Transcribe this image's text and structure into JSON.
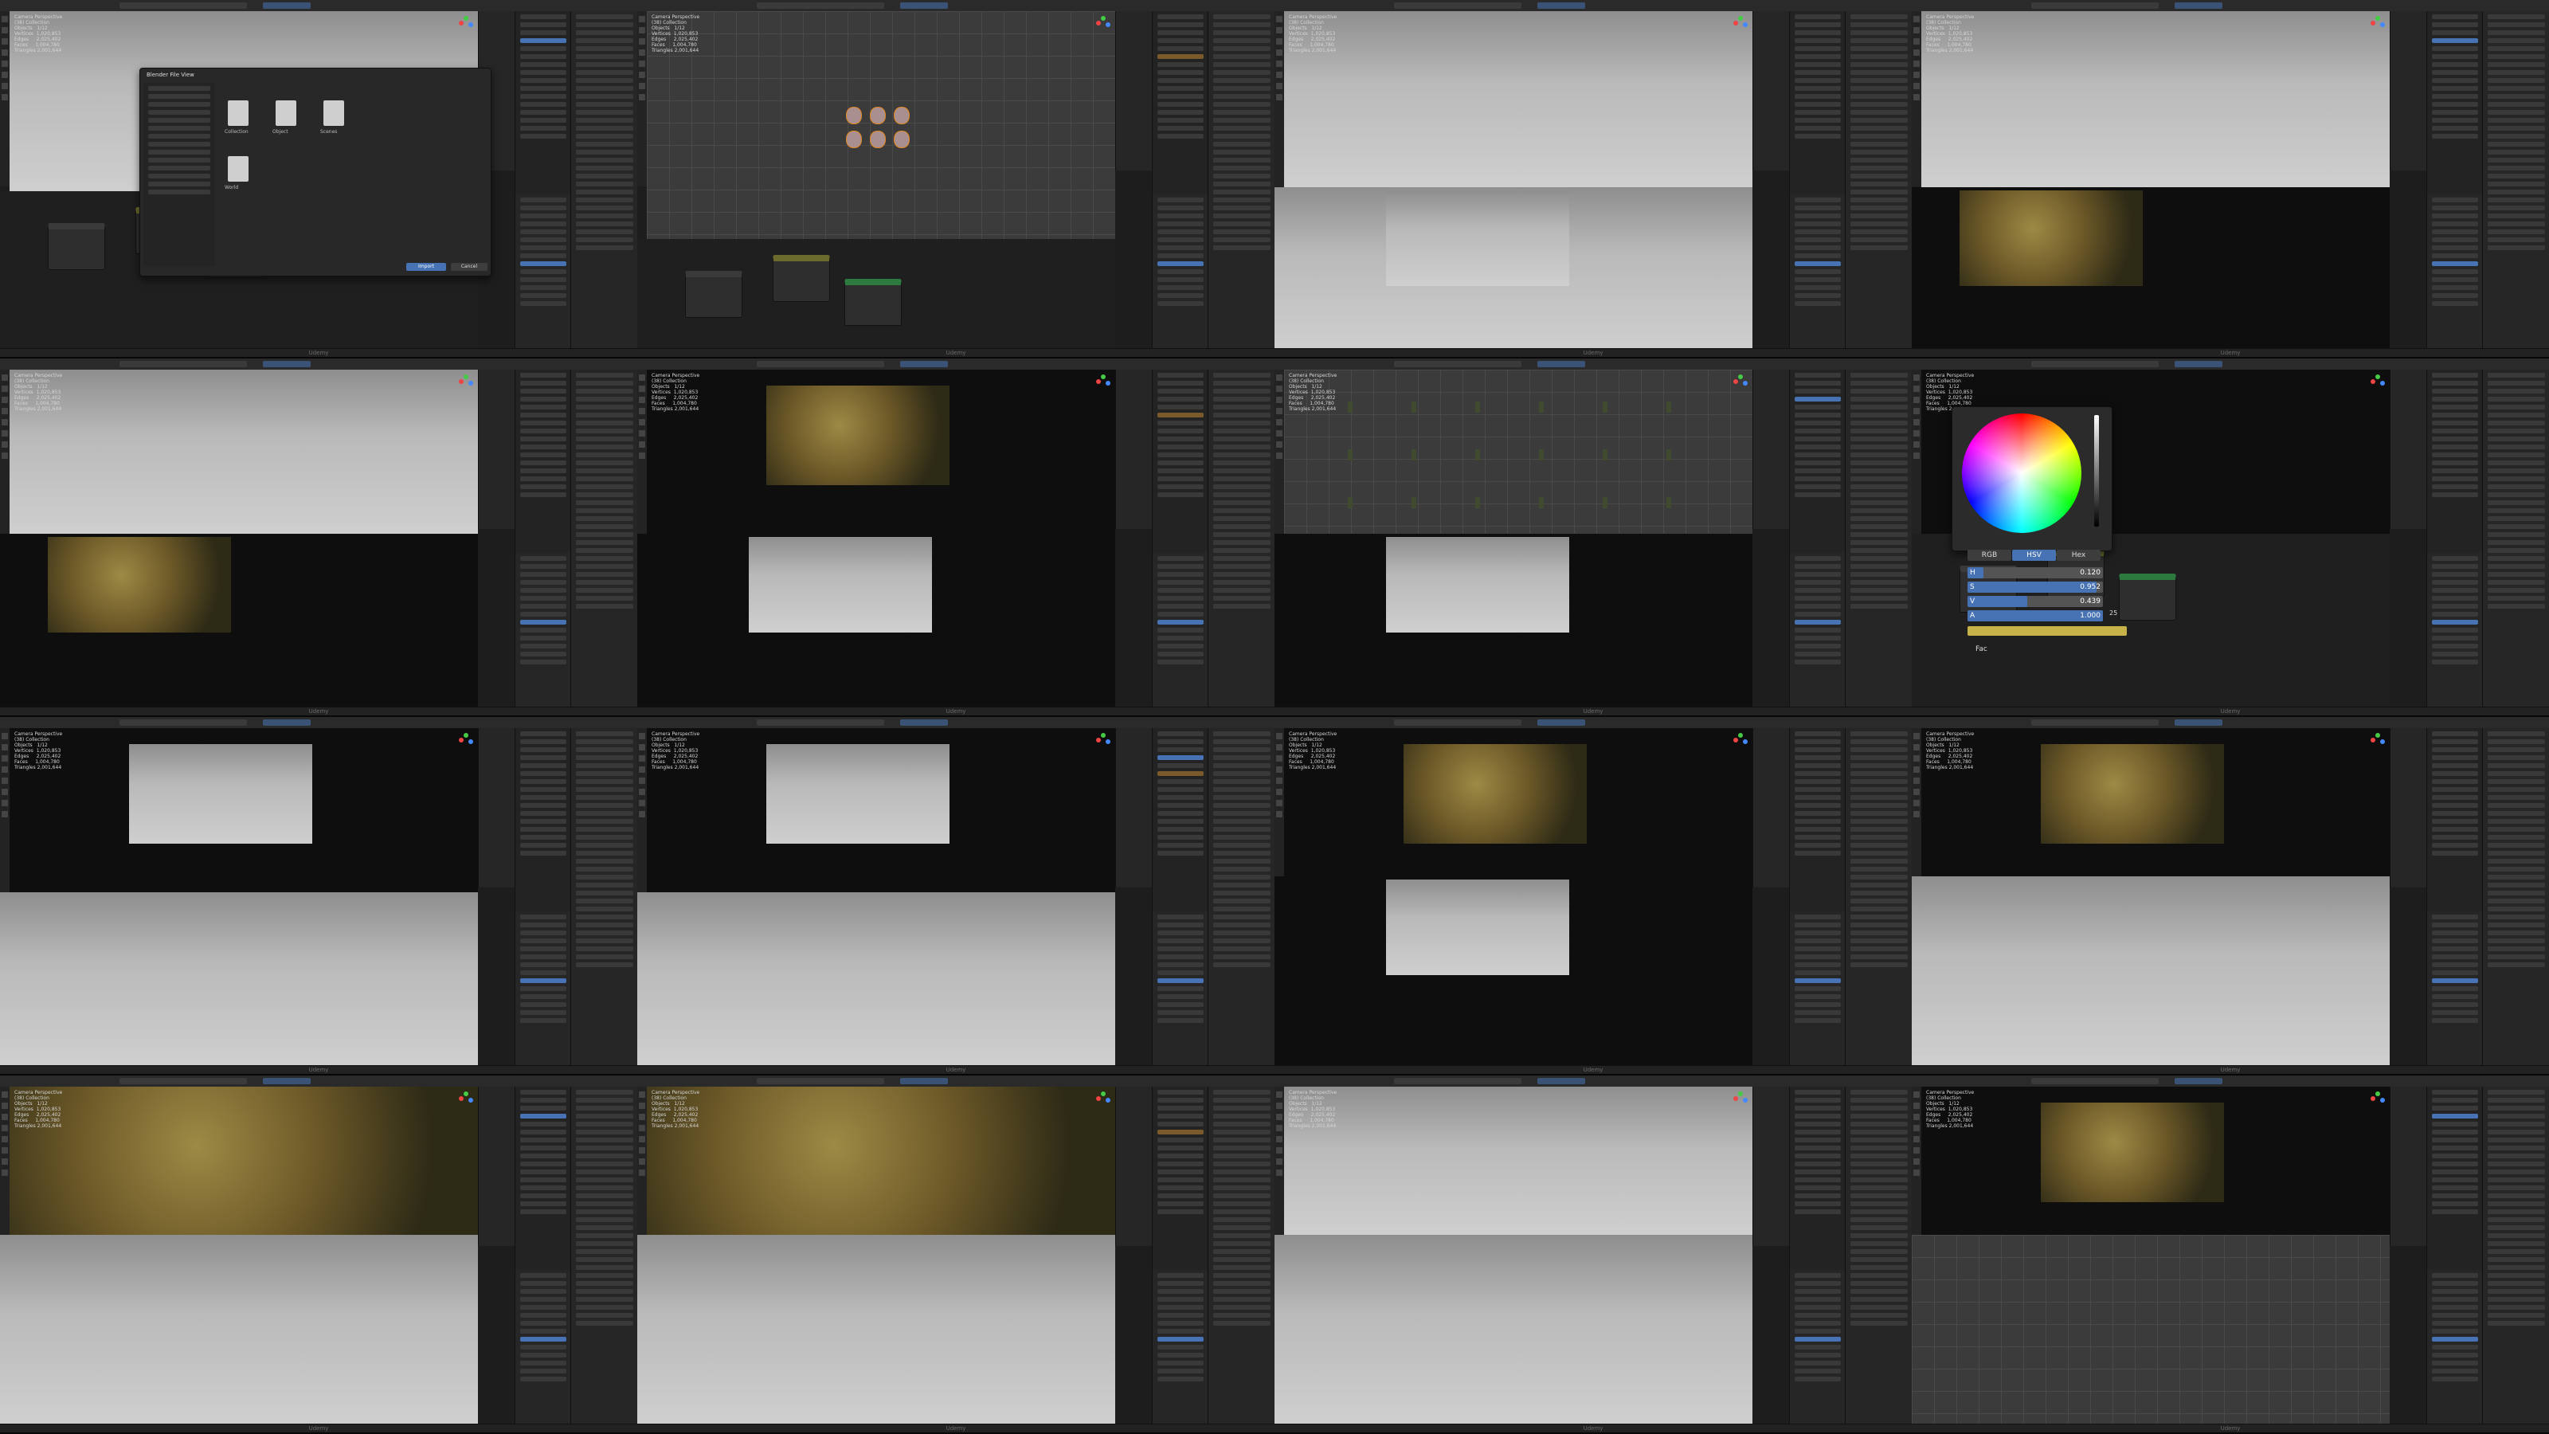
{
  "app": {
    "watermark": "Udemy"
  },
  "colors": {
    "accent": "#4772b3",
    "selection": "#e0861c",
    "swatch": "#c8b24a"
  },
  "tile1": {
    "file_browser": {
      "title": "Blender File View",
      "files": [
        "Collection",
        "Object",
        "Scenes",
        "World"
      ],
      "ok_label": "Import",
      "cancel_label": "Cancel"
    }
  },
  "tile8": {
    "color_picker": {
      "modes": [
        "RGB",
        "HSV",
        "Hex"
      ],
      "active_mode": "HSV",
      "fields": [
        {
          "label": "H",
          "value": "0.120",
          "fraction": 0.12
        },
        {
          "label": "S",
          "value": "0.952",
          "fraction": 0.952
        },
        {
          "label": "V",
          "value": "0.439",
          "fraction": 0.439
        },
        {
          "label": "A",
          "value": "1.000",
          "fraction": 1.0
        }
      ],
      "fac_label": "Fac",
      "side_value": "25"
    }
  },
  "stats_overlay": "Camera Perspective\n(38) Collection\nObjects   1/12\nVertices  1,020,853\nEdges     2,025,402\nFaces     1,004,780\nTriangles 2,001,644"
}
